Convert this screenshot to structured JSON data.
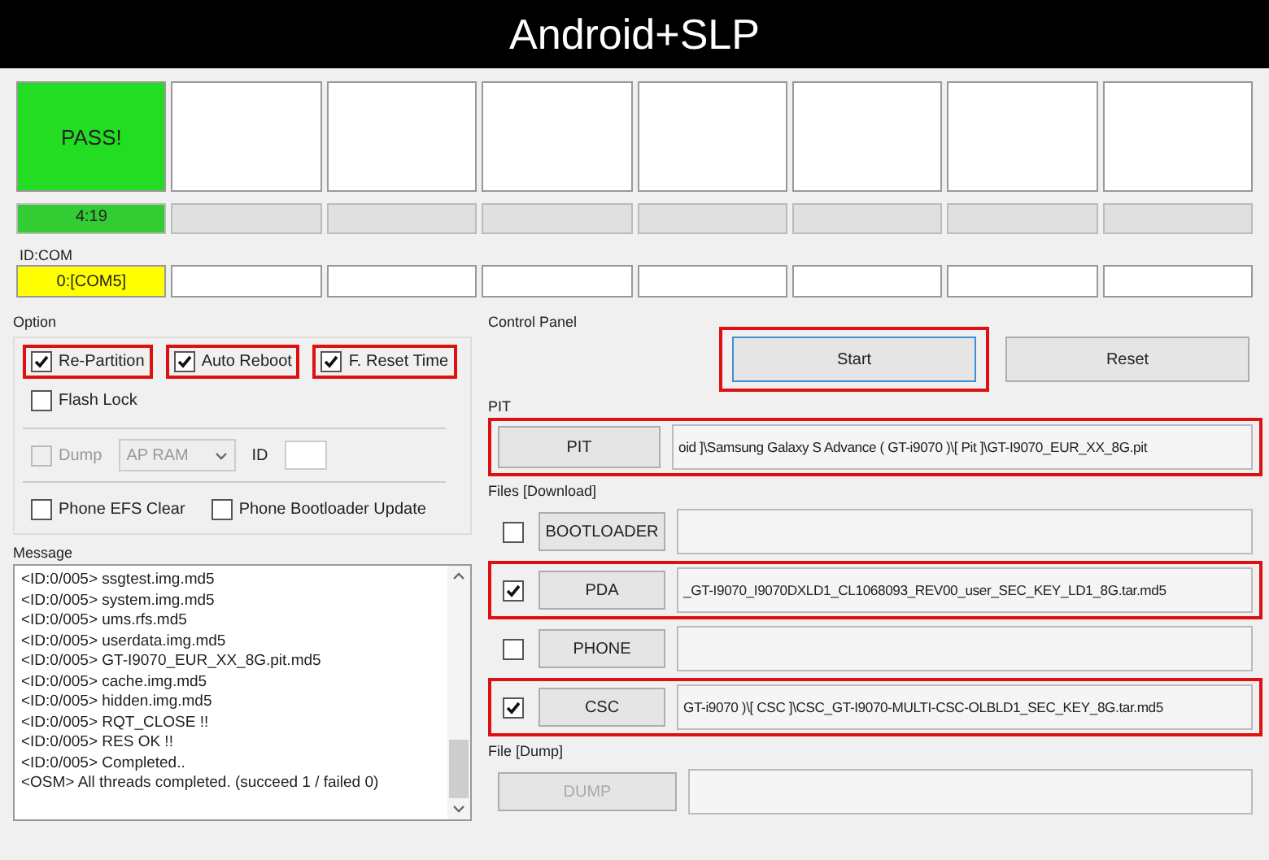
{
  "title": "Android+SLP",
  "status_boxes": [
    {
      "kind": "pass",
      "text": "PASS!"
    },
    {
      "kind": "empty"
    },
    {
      "kind": "empty"
    },
    {
      "kind": "empty"
    },
    {
      "kind": "empty"
    },
    {
      "kind": "empty"
    },
    {
      "kind": "empty"
    },
    {
      "kind": "empty"
    }
  ],
  "progress_bars": [
    {
      "level": 1,
      "text": "4:19"
    },
    {
      "level": 0
    },
    {
      "level": 0
    },
    {
      "level": 0
    },
    {
      "level": 0
    },
    {
      "level": 0
    },
    {
      "level": 0
    },
    {
      "level": 0
    }
  ],
  "id_com": {
    "label": "ID:COM",
    "ports": [
      {
        "kind": "connected",
        "text": "0:[COM5]"
      },
      {
        "kind": "empty"
      },
      {
        "kind": "empty"
      },
      {
        "kind": "empty"
      },
      {
        "kind": "empty"
      },
      {
        "kind": "empty"
      },
      {
        "kind": "empty"
      },
      {
        "kind": "empty"
      }
    ]
  },
  "option": {
    "label": "Option",
    "top_checkboxes": [
      {
        "label": "Re-Partition",
        "checked": true,
        "highlighted": true
      },
      {
        "label": "Auto Reboot",
        "checked": true,
        "highlighted": true
      },
      {
        "label": "F. Reset Time",
        "checked": true,
        "highlighted": true
      }
    ],
    "flash_lock": {
      "label": "Flash Lock",
      "checked": false
    },
    "dump": {
      "label": "Dump",
      "checked": false,
      "disabled": true,
      "select": "AP RAM",
      "id_label": "ID"
    },
    "bottom_checkboxes": [
      {
        "label": "Phone EFS Clear",
        "checked": false
      },
      {
        "label": "Phone Bootloader Update",
        "checked": false
      }
    ]
  },
  "message": {
    "label": "Message",
    "lines": [
      "<ID:0/005> ssgtest.img.md5",
      "<ID:0/005> system.img.md5",
      "<ID:0/005> ums.rfs.md5",
      "<ID:0/005> userdata.img.md5",
      "<ID:0/005> GT-I9070_EUR_XX_8G.pit.md5",
      "<ID:0/005> cache.img.md5",
      "<ID:0/005> hidden.img.md5",
      "<ID:0/005> RQT_CLOSE !!",
      "<ID:0/005> RES OK !!",
      "<ID:0/005> Completed..",
      "<OSM> All threads completed. (succeed 1 / failed 0)"
    ]
  },
  "control_panel": {
    "label": "Control Panel",
    "buttons": [
      {
        "label": "Start",
        "highlighted": true
      },
      {
        "label": "Reset",
        "highlighted": false
      }
    ]
  },
  "pit": {
    "label": "PIT",
    "button": "PIT",
    "path": "oid ]\\Samsung Galaxy S Advance ( GT-i9070 )\\[ Pit ]\\GT-I9070_EUR_XX_8G.pit",
    "highlighted": true
  },
  "files": {
    "label": "Files [Download]",
    "rows": [
      {
        "button": "BOOTLOADER",
        "checked": false,
        "highlighted": false
      },
      {
        "button": "PDA",
        "checked": true,
        "highlighted": true,
        "path": "_GT-I9070_I9070DXLD1_CL1068093_REV00_user_SEC_KEY_LD1_8G.tar.md5"
      },
      {
        "button": "PHONE",
        "checked": false,
        "highlighted": false
      },
      {
        "button": "CSC",
        "checked": true,
        "highlighted": true,
        "path": "GT-i9070 )\\[ CSC ]\\CSC_GT-I9070-MULTI-CSC-OLBLD1_SEC_KEY_8G.tar.md5"
      }
    ]
  },
  "file_dump": {
    "label": "File [Dump]",
    "button": "DUMP",
    "disabled": true
  }
}
